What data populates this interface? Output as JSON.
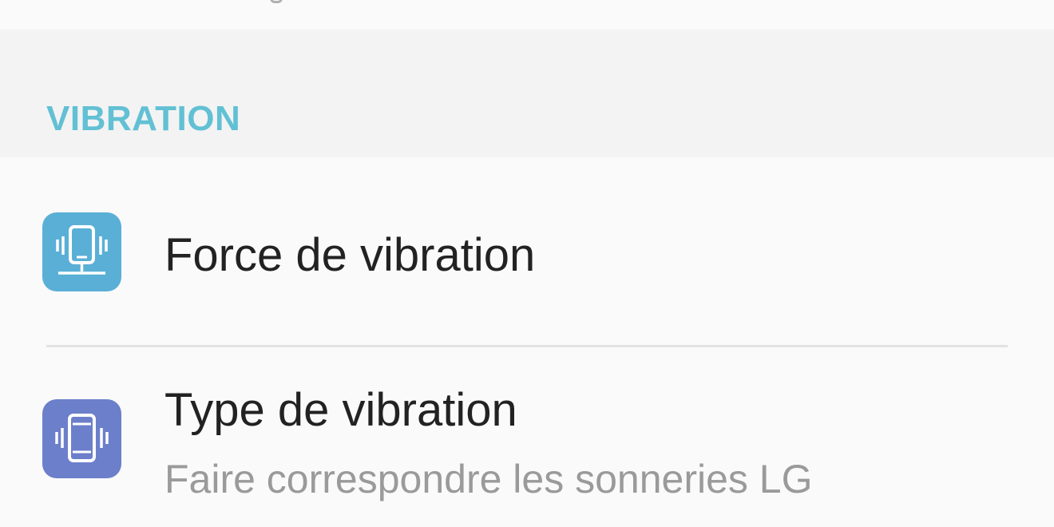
{
  "section": {
    "title": "VIBRATION"
  },
  "items": [
    {
      "title": "Force de vibration",
      "icon": "vibration-strength-icon",
      "icon_color": "#5aafd6"
    },
    {
      "title": "Type de vibration",
      "subtitle": "Faire correspondre les sonneries LG",
      "icon": "vibration-type-icon",
      "icon_color": "#6b7fcb"
    }
  ],
  "colors": {
    "section_title": "#62c0d4",
    "title_text": "#222222",
    "subtitle_text": "#9a9a9a",
    "background": "#fafafa",
    "header_background": "#f3f3f3"
  }
}
